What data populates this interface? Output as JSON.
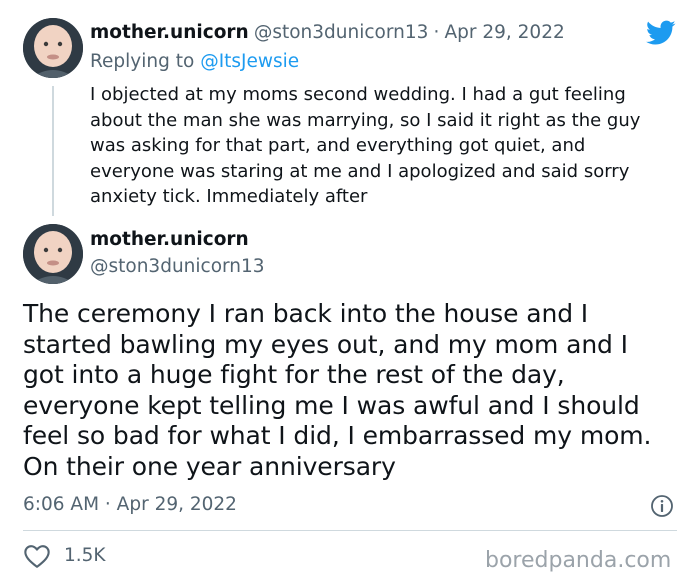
{
  "reply_tweet": {
    "display_name": "mother.unicorn",
    "handle": "@ston3dunicorn13",
    "separator": "·",
    "date": "Apr 29, 2022",
    "replying_prefix": "Replying to",
    "replying_to": "@ItsJewsie",
    "lines": [
      "I objected at my moms second wedding. I had a gut feeling",
      "about the man she was marrying, so I said it right as the guy",
      "was asking for that part, and everything got quiet, and",
      "everyone was staring at me and I apologized and said sorry",
      "anxiety tick. Immediately after"
    ]
  },
  "main_tweet": {
    "display_name": "mother.unicorn",
    "handle": "@ston3dunicorn13",
    "lines": [
      "The ceremony I ran back into the house and I",
      "started bawling my eyes out, and my mom and I",
      "got into a huge fight for the rest of the day,",
      "everyone kept telling me I was awful and I should",
      "feel so bad for what I did, I embarrassed my mom.",
      "On their one year anniversary"
    ],
    "timestamp": "6:06 AM · Apr 29, 2022",
    "likes": "1.5K"
  },
  "watermark": "boredpanda.com",
  "colors": {
    "twitter_blue": "#1d9bf0",
    "muted": "#536471",
    "divider": "#cfd9de"
  },
  "icons": [
    "twitter-bird-icon",
    "info-icon",
    "heart-icon"
  ]
}
